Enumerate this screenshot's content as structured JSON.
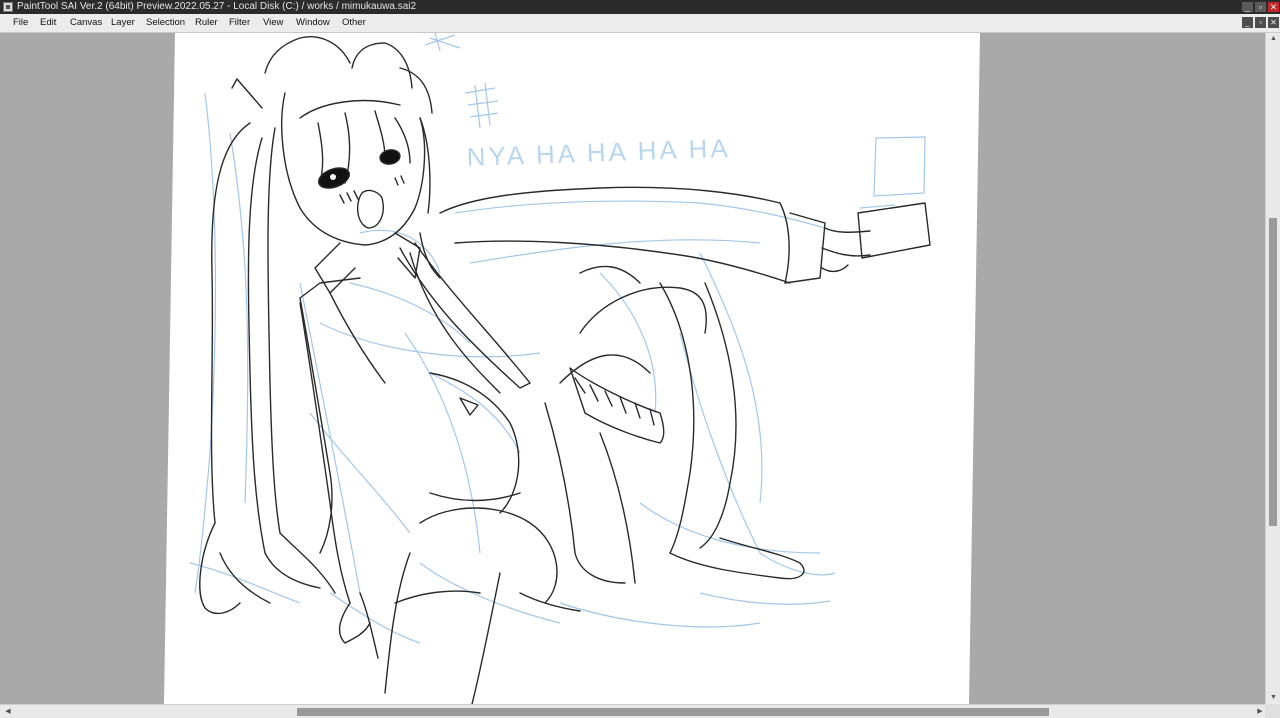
{
  "window": {
    "title": "PaintTool SAI Ver.2 (64bit) Preview.2022.05.27 - Local Disk (C:) / works / mimukauwa.sai2",
    "minimize": "_",
    "maximize": "▫",
    "close": "✕"
  },
  "menu": {
    "items": [
      {
        "label": "File"
      },
      {
        "label": "Edit"
      },
      {
        "label": "Canvas"
      },
      {
        "label": "Layer"
      },
      {
        "label": "Selection"
      },
      {
        "label": "Ruler"
      },
      {
        "label": "Filter"
      },
      {
        "label": "View"
      },
      {
        "label": "Window"
      },
      {
        "label": "Other"
      }
    ],
    "doc_minimize": "_",
    "doc_restore": "▫",
    "doc_close": "✕"
  },
  "canvas": {
    "sketch_text": "NYA HA HA HA HA",
    "background_color": "#ffffff",
    "workspace_color": "#a9a9a9",
    "sketch_blue": "#9ec5ea",
    "line_color": "#2a2a2a"
  },
  "scrollbars": {
    "vertical_arrow_up": "▲",
    "vertical_arrow_down": "▼",
    "horizontal_arrow_left": "◀",
    "horizontal_arrow_right": "▶"
  }
}
